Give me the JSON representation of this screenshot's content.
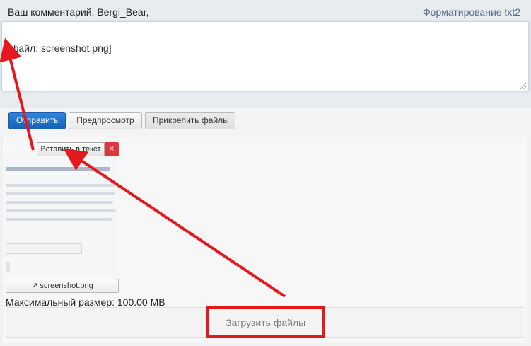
{
  "header": {
    "comment_label": "Ваш комментарий, Bergi_Bear,",
    "format_link": "Форматирование txt2"
  },
  "editor": {
    "value": "[файл: screenshot.png]"
  },
  "toolbar": {
    "send_label": "Отправить",
    "preview_label": "Предпросмотр",
    "attach_label": "Прикрепить файлы"
  },
  "attachment": {
    "insert_label": "Вставить в текст",
    "close_label": "×",
    "file_label": "↗ screenshot.png",
    "thumbnail_icon": "image-thumbnail"
  },
  "upload": {
    "max_size_text": "Максимальный размер: 100.00 MB",
    "upload_label": "Загрузить файлы"
  },
  "colors": {
    "primary_button": "#1e6fcb",
    "annotation_red": "#e5181e",
    "close_red": "#d9383c"
  }
}
